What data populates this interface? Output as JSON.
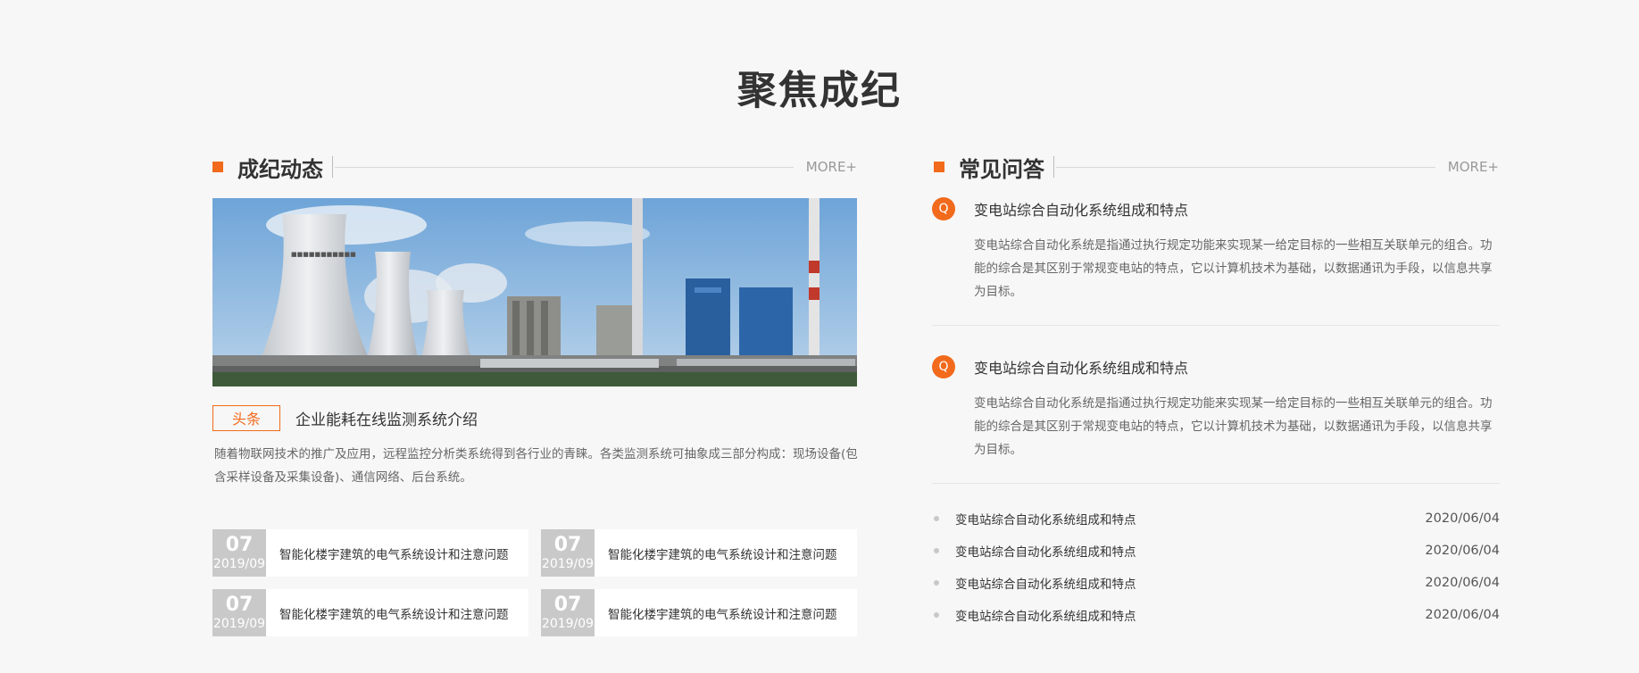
{
  "main_title": "聚焦成纪",
  "news": {
    "title": "成纪动态",
    "more": "MORE+",
    "hero_image": "power-plant-cooling-towers",
    "tag": "头条",
    "headline": "企业能耗在线监测系统介绍",
    "summary": "随着物联网技术的推广及应用，远程监控分析类系统得到各行业的青睐。各类监测系统可抽象成三部分构成：现场设备(包含采样设备及采集设备)、通信网络、后台系统。",
    "cards": [
      {
        "day": "07",
        "ym": "2019/09",
        "title": "智能化楼宇建筑的电气系统设计和注意问题"
      },
      {
        "day": "07",
        "ym": "2019/09",
        "title": "智能化楼宇建筑的电气系统设计和注意问题"
      },
      {
        "day": "07",
        "ym": "2019/09",
        "title": "智能化楼宇建筑的电气系统设计和注意问题"
      },
      {
        "day": "07",
        "ym": "2019/09",
        "title": "智能化楼宇建筑的电气系统设计和注意问题"
      }
    ]
  },
  "faq": {
    "title": "常见问答",
    "more": "MORE+",
    "q_label": "Q",
    "items": [
      {
        "question": "变电站综合自动化系统组成和特点",
        "answer": "变电站综合自动化系统是指通过执行规定功能来实现某一给定目标的一些相互关联单元的组合。功能的综合是其区别于常规变电站的特点，它以计算机技术为基础，以数据通讯为手段，以信息共享为目标。"
      },
      {
        "question": "变电站综合自动化系统组成和特点",
        "answer": "变电站综合自动化系统是指通过执行规定功能来实现某一给定目标的一些相互关联单元的组合。功能的综合是其区别于常规变电站的特点，它以计算机技术为基础，以数据通讯为手段，以信息共享为目标。"
      }
    ],
    "list": [
      {
        "title": "变电站综合自动化系统组成和特点",
        "date": "2020/06/04"
      },
      {
        "title": "变电站综合自动化系统组成和特点",
        "date": "2020/06/04"
      },
      {
        "title": "变电站综合自动化系统组成和特点",
        "date": "2020/06/04"
      },
      {
        "title": "变电站综合自动化系统组成和特点",
        "date": "2020/06/04"
      }
    ]
  },
  "colors": {
    "accent": "#f26a1b",
    "date_box": "#c9c9c9",
    "background": "#f7f7f7"
  }
}
